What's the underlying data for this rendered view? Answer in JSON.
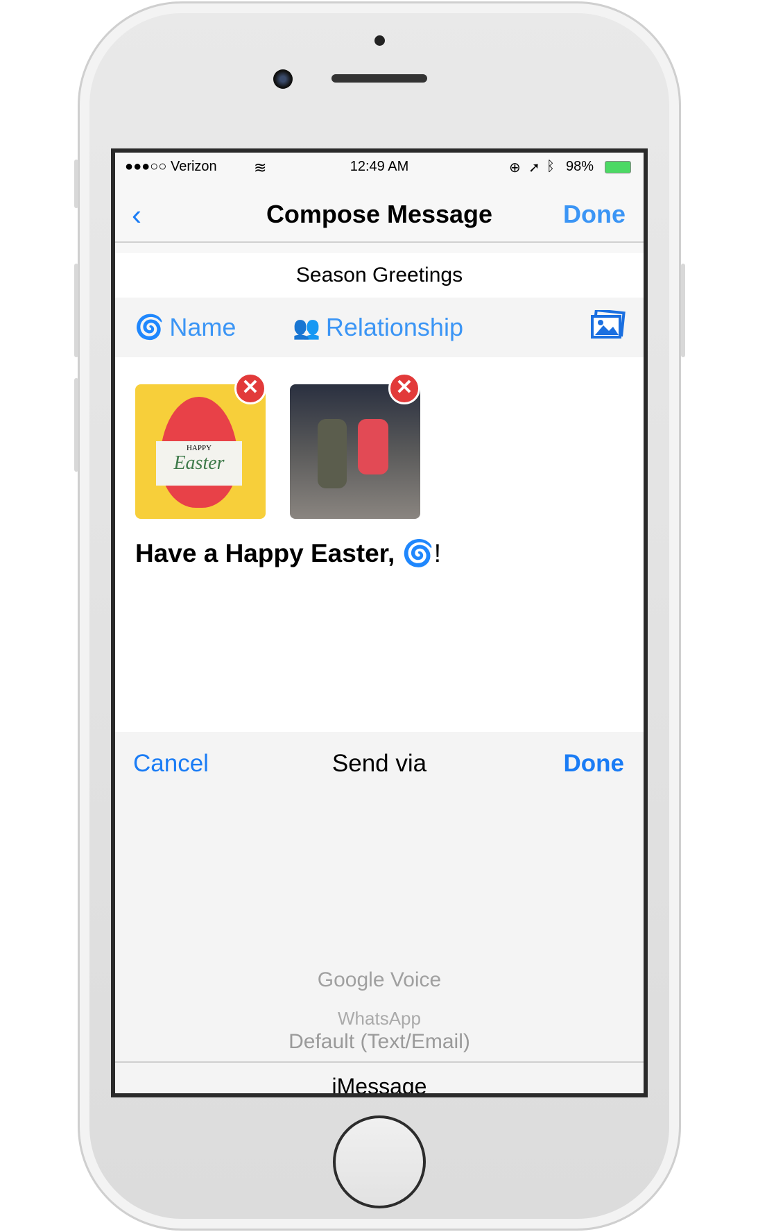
{
  "status": {
    "carrier": "●●●○○ Verizon",
    "time": "12:49 AM",
    "battery": "98%",
    "battery_color": "#4cd964"
  },
  "nav": {
    "back_icon": "chevron-left",
    "title": "Compose Message",
    "done": "Done",
    "accent": "#3b95f5"
  },
  "subject": "Season Greetings",
  "tokens": {
    "name": "Name",
    "relationship": "Relationship",
    "photo_icon": "photos-icon"
  },
  "attachments": [
    {
      "label": "HAPPY",
      "script": "Easter"
    },
    {
      "label": "kids-photo"
    }
  ],
  "message": {
    "text": "Have a  Happy Easter, ",
    "suffix": "!"
  },
  "picker": {
    "cancel": "Cancel",
    "title": "Send via",
    "done": "Done",
    "options": [
      "Default (Text/Email)",
      "iMessage",
      "Google Voice",
      "WhatsApp"
    ],
    "selected": "iMessage"
  }
}
